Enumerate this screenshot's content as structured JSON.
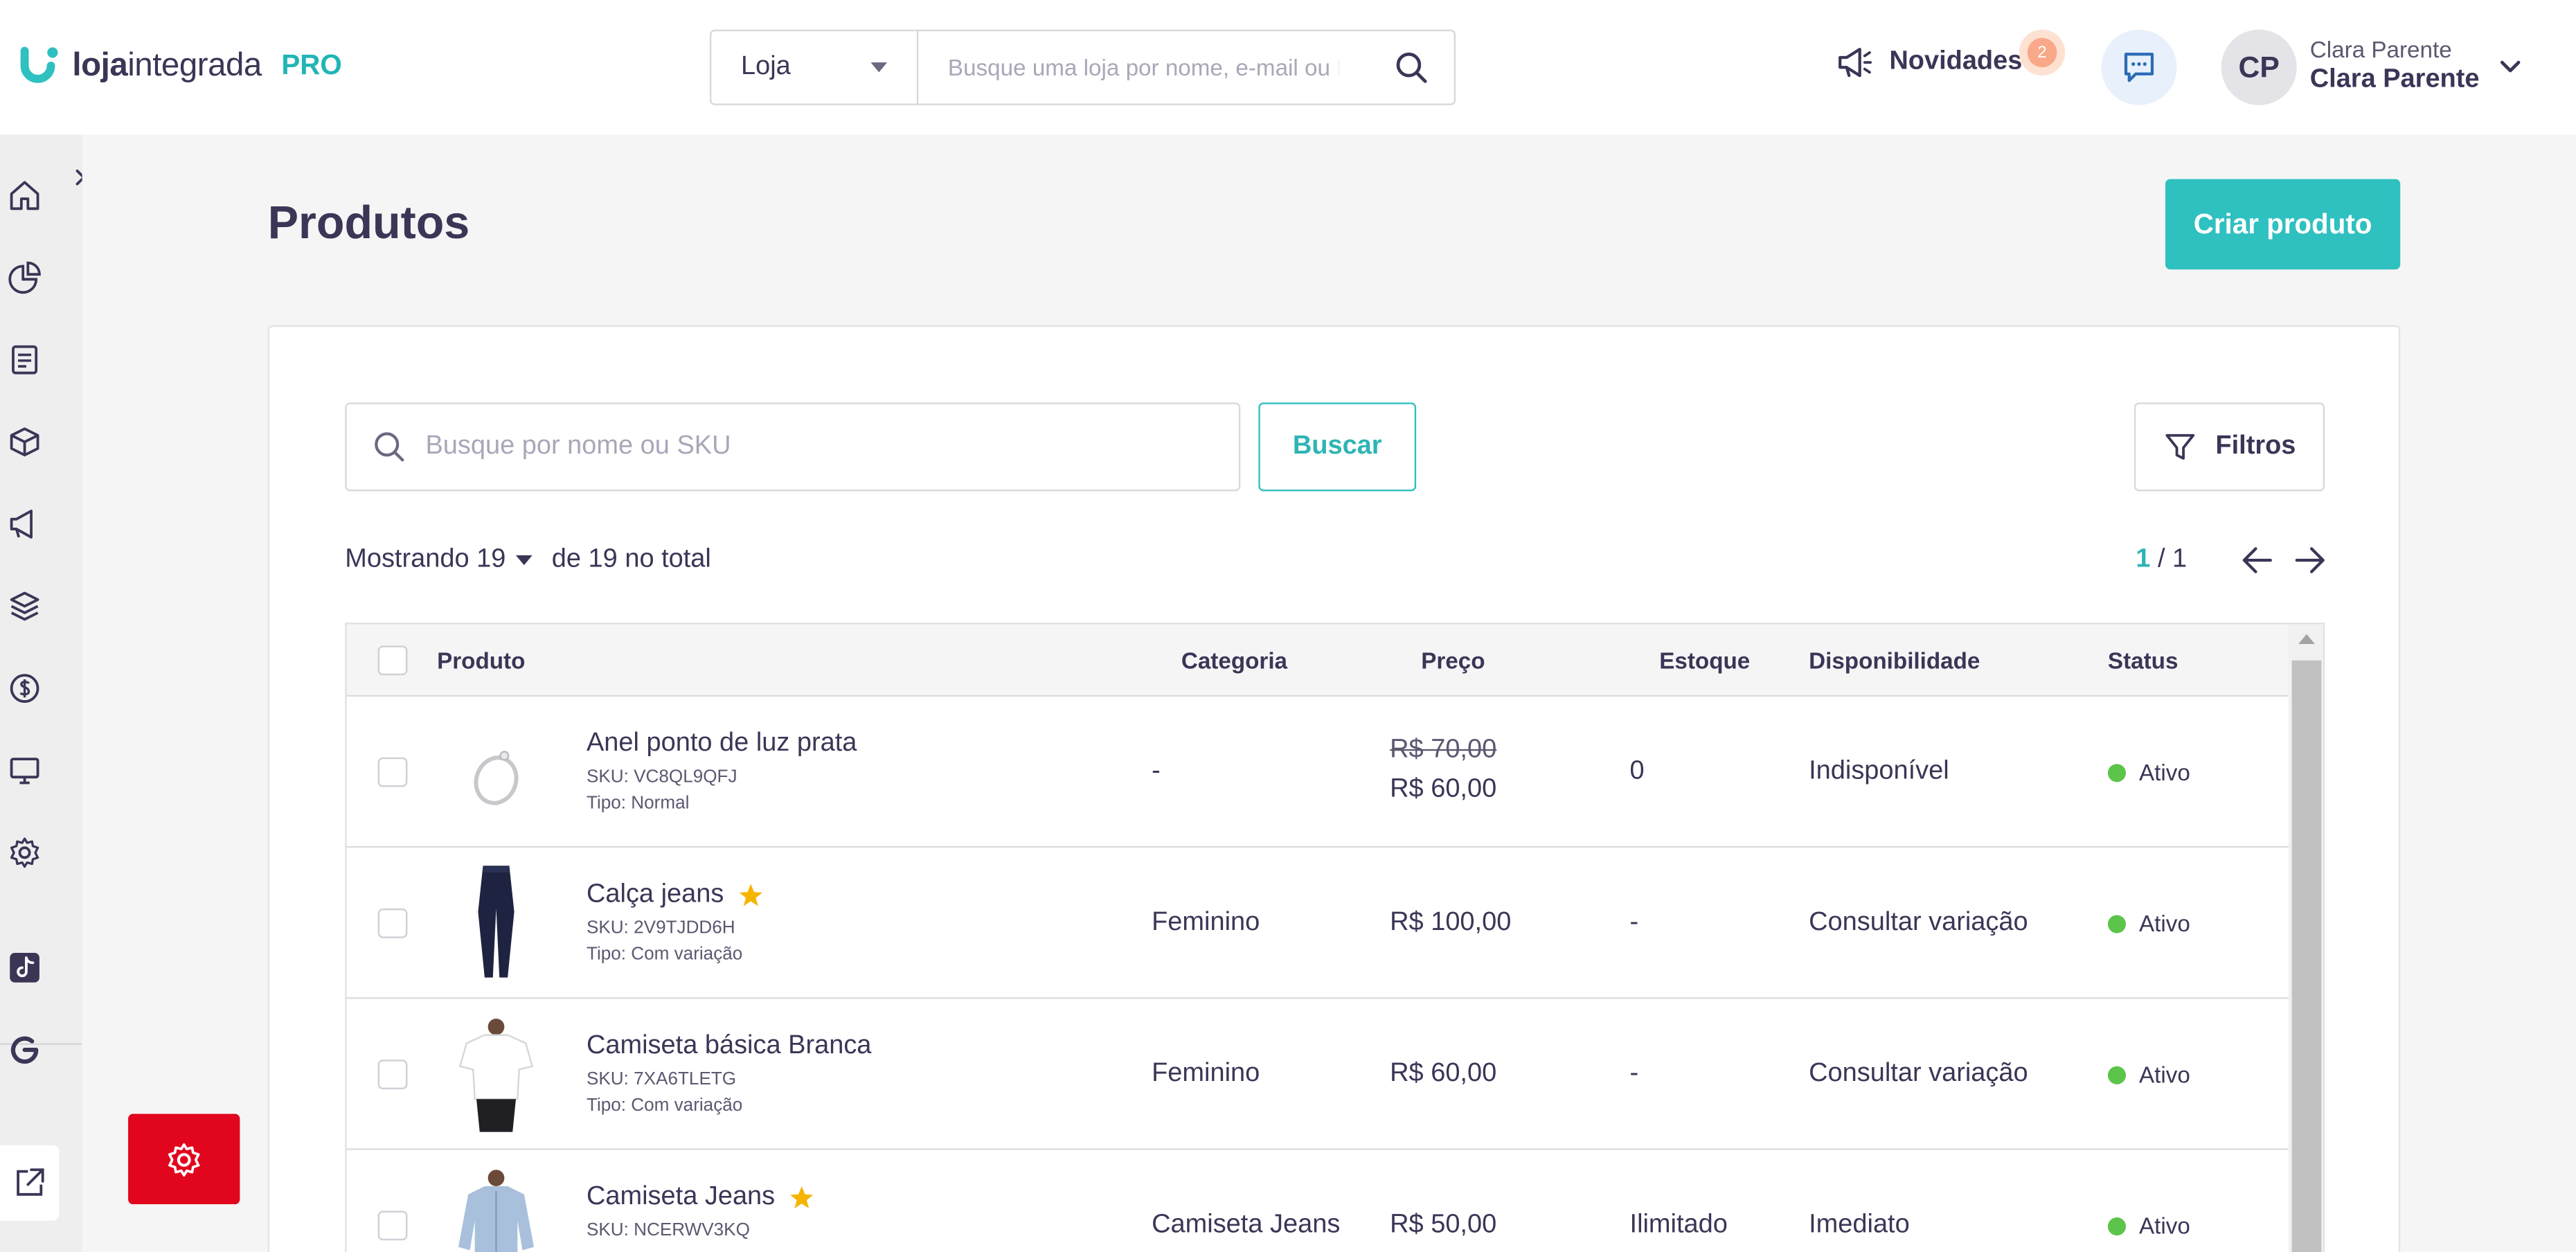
{
  "brand": {
    "name_bold": "loja",
    "name_rest": "integrada",
    "tier": "PRO",
    "accent": "#2fc0c0"
  },
  "store_search": {
    "scope": "Loja",
    "placeholder": "Busque uma loja por nome, e-mail ou ID"
  },
  "header": {
    "news_label": "Novidades",
    "news_count": "2",
    "user_initials": "CP",
    "user_name_small": "Clara Parente",
    "user_name_big": "Clara Parente"
  },
  "page": {
    "title": "Produtos",
    "create_label": "Criar produto"
  },
  "filters": {
    "search_placeholder": "Busque por nome ou SKU",
    "search_button": "Buscar",
    "filters_button": "Filtros"
  },
  "listing": {
    "showing_prefix": "Mostrando 19",
    "showing_suffix": "de 19 no total",
    "page_current": "1",
    "page_total": "/ 1"
  },
  "table": {
    "headers": {
      "product": "Produto",
      "category": "Categoria",
      "price": "Preço",
      "stock": "Estoque",
      "availability": "Disponibilidade",
      "status": "Status"
    },
    "rows": [
      {
        "name": "Anel ponto de luz prata",
        "sku": "SKU: VC8QL9QFJ",
        "type": "Tipo: Normal",
        "category": "-",
        "price_old": "R$ 70,00",
        "price": "R$ 60,00",
        "stock": "0",
        "availability": "Indisponível",
        "status": "Ativo",
        "featured": false,
        "image": "ring"
      },
      {
        "name": "Calça jeans",
        "sku": "SKU: 2V9TJDD6H",
        "type": "Tipo: Com variação",
        "category": "Feminino",
        "price_old": "",
        "price": "R$ 100,00",
        "stock": "-",
        "availability": "Consultar variação",
        "status": "Ativo",
        "featured": true,
        "image": "jeans"
      },
      {
        "name": "Camiseta básica Branca",
        "sku": "SKU: 7XA6TLETG",
        "type": "Tipo: Com variação",
        "category": "Feminino",
        "price_old": "",
        "price": "R$ 60,00",
        "stock": "-",
        "availability": "Consultar variação",
        "status": "Ativo",
        "featured": false,
        "image": "tshirt"
      },
      {
        "name": "Camiseta Jeans",
        "sku": "SKU: NCERWV3KQ",
        "type": "",
        "category": "Camiseta Jeans",
        "price_old": "",
        "price": "R$ 50,00",
        "stock": "Ilimitado",
        "availability": "Imediato",
        "status": "Ativo",
        "featured": true,
        "image": "denim-shirt"
      }
    ]
  },
  "colors": {
    "status_active": "#5cc44a",
    "danger": "#e1061d",
    "star": "#f5b400"
  }
}
